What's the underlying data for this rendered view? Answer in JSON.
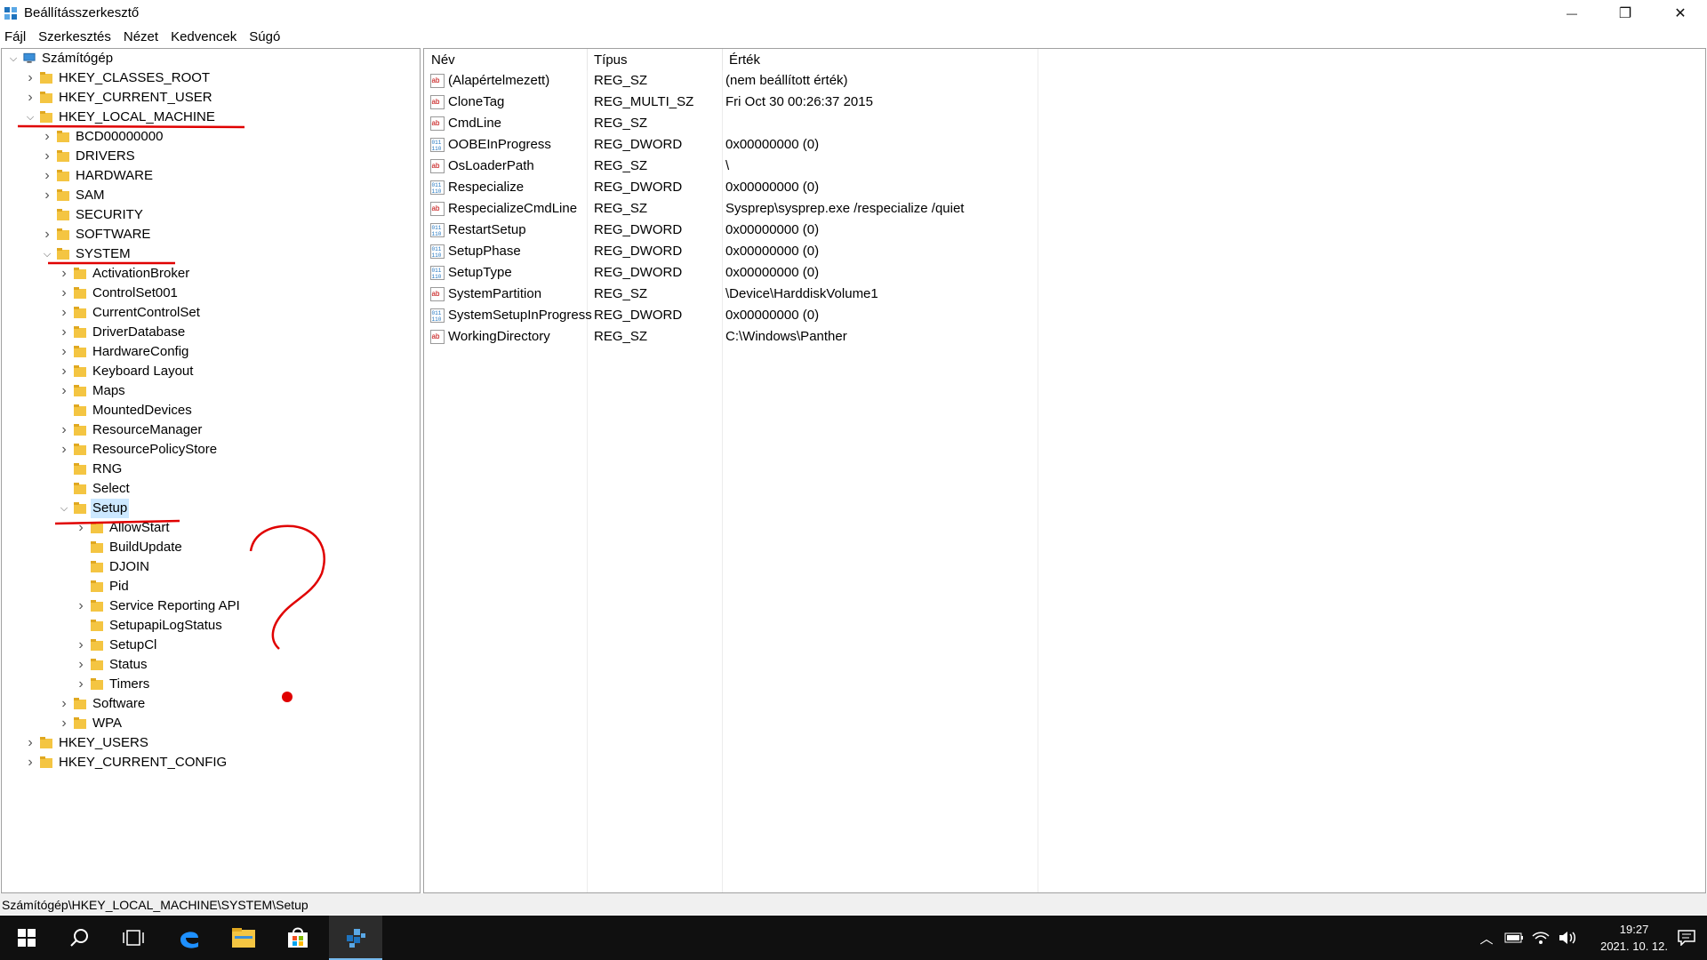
{
  "window": {
    "title": "Beállításszerkesztő",
    "controls": {
      "minimize": "—",
      "restore": "❐",
      "close": "✕"
    }
  },
  "menu": [
    "Fájl",
    "Szerkesztés",
    "Nézet",
    "Kedvencek",
    "Súgó"
  ],
  "tree": [
    {
      "label": "Számítógép",
      "depth": 0,
      "expander": "open",
      "icon": "computer-icon"
    },
    {
      "label": "HKEY_CLASSES_ROOT",
      "depth": 1,
      "expander": "closed"
    },
    {
      "label": "HKEY_CURRENT_USER",
      "depth": 1,
      "expander": "closed"
    },
    {
      "label": "HKEY_LOCAL_MACHINE",
      "depth": 1,
      "expander": "open"
    },
    {
      "label": "BCD00000000",
      "depth": 2,
      "expander": "closed"
    },
    {
      "label": "DRIVERS",
      "depth": 2,
      "expander": "closed"
    },
    {
      "label": "HARDWARE",
      "depth": 2,
      "expander": "closed"
    },
    {
      "label": "SAM",
      "depth": 2,
      "expander": "closed"
    },
    {
      "label": "SECURITY",
      "depth": 2,
      "expander": "none"
    },
    {
      "label": "SOFTWARE",
      "depth": 2,
      "expander": "closed"
    },
    {
      "label": "SYSTEM",
      "depth": 2,
      "expander": "open"
    },
    {
      "label": "ActivationBroker",
      "depth": 3,
      "expander": "closed"
    },
    {
      "label": "ControlSet001",
      "depth": 3,
      "expander": "closed"
    },
    {
      "label": "CurrentControlSet",
      "depth": 3,
      "expander": "closed"
    },
    {
      "label": "DriverDatabase",
      "depth": 3,
      "expander": "closed"
    },
    {
      "label": "HardwareConfig",
      "depth": 3,
      "expander": "closed"
    },
    {
      "label": "Keyboard Layout",
      "depth": 3,
      "expander": "closed"
    },
    {
      "label": "Maps",
      "depth": 3,
      "expander": "closed"
    },
    {
      "label": "MountedDevices",
      "depth": 3,
      "expander": "none"
    },
    {
      "label": "ResourceManager",
      "depth": 3,
      "expander": "closed"
    },
    {
      "label": "ResourcePolicyStore",
      "depth": 3,
      "expander": "closed"
    },
    {
      "label": "RNG",
      "depth": 3,
      "expander": "none"
    },
    {
      "label": "Select",
      "depth": 3,
      "expander": "none"
    },
    {
      "label": "Setup",
      "depth": 3,
      "expander": "open",
      "selected": true
    },
    {
      "label": "AllowStart",
      "depth": 4,
      "expander": "closed"
    },
    {
      "label": "BuildUpdate",
      "depth": 4,
      "expander": "none"
    },
    {
      "label": "DJOIN",
      "depth": 4,
      "expander": "none"
    },
    {
      "label": "Pid",
      "depth": 4,
      "expander": "none"
    },
    {
      "label": "Service Reporting API",
      "depth": 4,
      "expander": "closed"
    },
    {
      "label": "SetupapiLogStatus",
      "depth": 4,
      "expander": "none"
    },
    {
      "label": "SetupCl",
      "depth": 4,
      "expander": "closed"
    },
    {
      "label": "Status",
      "depth": 4,
      "expander": "closed"
    },
    {
      "label": "Timers",
      "depth": 4,
      "expander": "closed"
    },
    {
      "label": "Software",
      "depth": 3,
      "expander": "closed"
    },
    {
      "label": "WPA",
      "depth": 3,
      "expander": "closed"
    },
    {
      "label": "HKEY_USERS",
      "depth": 1,
      "expander": "closed"
    },
    {
      "label": "HKEY_CURRENT_CONFIG",
      "depth": 1,
      "expander": "closed"
    }
  ],
  "list": {
    "headers": {
      "name": "Név",
      "type": "Típus",
      "data": "Érték"
    },
    "rows": [
      {
        "name": "(Alapértelmezett)",
        "type": "REG_SZ",
        "data": "(nem beállított érték)",
        "icon": "string-value-icon"
      },
      {
        "name": "CloneTag",
        "type": "REG_MULTI_SZ",
        "data": "Fri Oct 30 00:26:37 2015",
        "icon": "string-value-icon"
      },
      {
        "name": "CmdLine",
        "type": "REG_SZ",
        "data": "",
        "icon": "string-value-icon"
      },
      {
        "name": "OOBEInProgress",
        "type": "REG_DWORD",
        "data": "0x00000000 (0)",
        "icon": "binary-value-icon"
      },
      {
        "name": "OsLoaderPath",
        "type": "REG_SZ",
        "data": "\\",
        "icon": "string-value-icon"
      },
      {
        "name": "Respecialize",
        "type": "REG_DWORD",
        "data": "0x00000000 (0)",
        "icon": "binary-value-icon"
      },
      {
        "name": "RespecializeCmdLine",
        "type": "REG_SZ",
        "data": "Sysprep\\sysprep.exe /respecialize /quiet",
        "icon": "string-value-icon"
      },
      {
        "name": "RestartSetup",
        "type": "REG_DWORD",
        "data": "0x00000000 (0)",
        "icon": "binary-value-icon"
      },
      {
        "name": "SetupPhase",
        "type": "REG_DWORD",
        "data": "0x00000000 (0)",
        "icon": "binary-value-icon"
      },
      {
        "name": "SetupType",
        "type": "REG_DWORD",
        "data": "0x00000000 (0)",
        "icon": "binary-value-icon"
      },
      {
        "name": "SystemPartition",
        "type": "REG_SZ",
        "data": "\\Device\\HarddiskVolume1",
        "icon": "string-value-icon"
      },
      {
        "name": "SystemSetupInProgress",
        "type": "REG_DWORD",
        "data": "0x00000000 (0)",
        "icon": "binary-value-icon"
      },
      {
        "name": "WorkingDirectory",
        "type": "REG_SZ",
        "data": "C:\\Windows\\Panther",
        "icon": "string-value-icon"
      }
    ]
  },
  "status": {
    "path": "Számítógép\\HKEY_LOCAL_MACHINE\\SYSTEM\\Setup"
  },
  "taskbar": {
    "apps": [
      "start-icon",
      "search-icon",
      "task-view-icon",
      "edge-icon",
      "file-explorer-icon",
      "store-icon",
      "regedit-icon"
    ],
    "active_app": "regedit-icon",
    "tray_icons": [
      "chevron-up-icon",
      "battery-icon",
      "network-icon",
      "volume-icon",
      "notification-icon"
    ],
    "time": "19:27",
    "date": "2021. 10. 12."
  },
  "colors": {
    "selection": "#cce8ff",
    "folder": "#f4c542",
    "annotation": "#e00000",
    "taskbar": "#101010"
  }
}
